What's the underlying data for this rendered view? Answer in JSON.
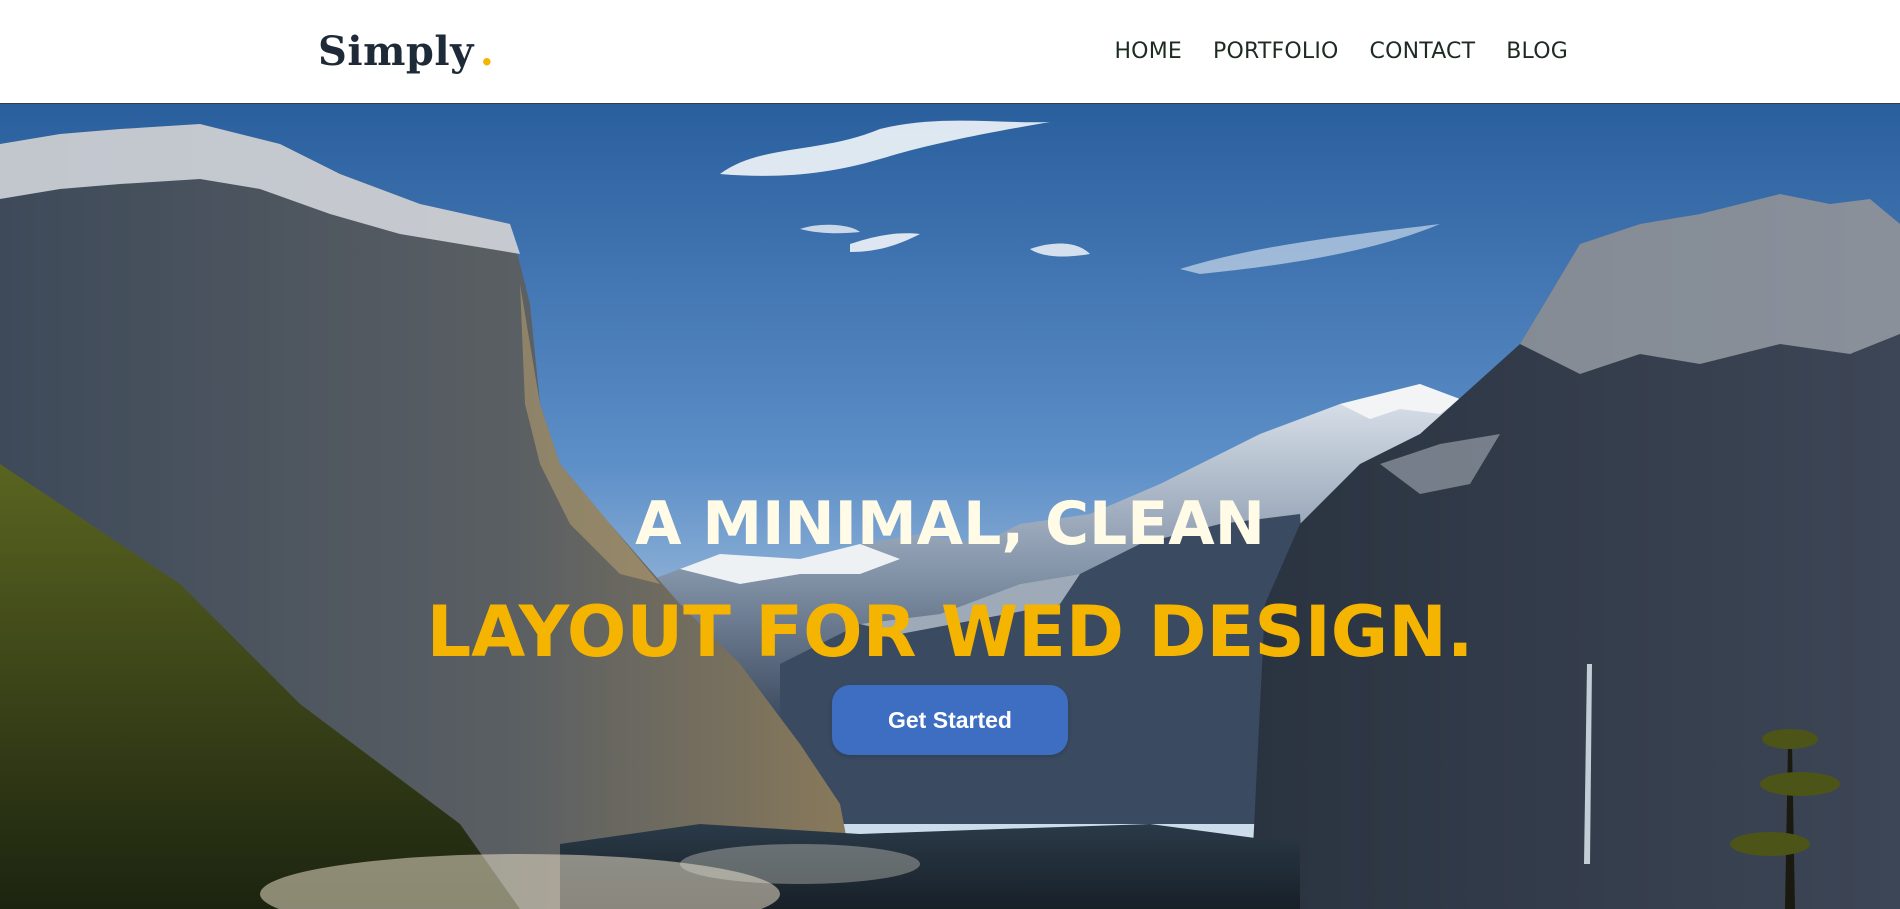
{
  "header": {
    "logo_text": "Simply",
    "logo_dot": ".",
    "nav": [
      {
        "label": "HOME"
      },
      {
        "label": "PORTFOLIO"
      },
      {
        "label": "CONTACT"
      },
      {
        "label": "BLOG"
      }
    ]
  },
  "hero": {
    "headline_line1": "A MINIMAL, CLEAN",
    "headline_line2": "LAYOUT FOR WED DESIGN.",
    "cta_label": "Get Started",
    "background_image": "mountain-valley-landscape"
  },
  "colors": {
    "accent": "#f5b400",
    "button": "#3d6ec2",
    "logo": "#1f2a38",
    "nav_text": "#1d2b22",
    "headline_light": "#fffbe6"
  }
}
